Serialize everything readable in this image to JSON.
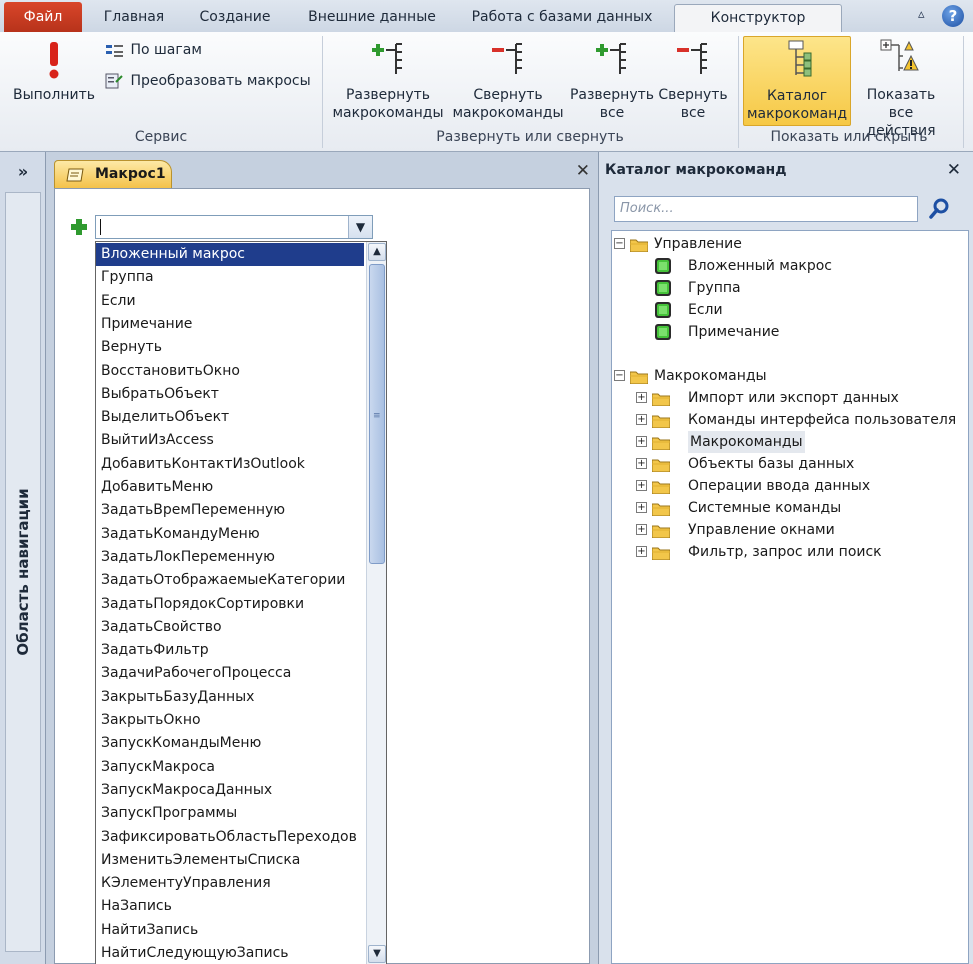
{
  "tabs": {
    "file": "Файл",
    "home": "Главная",
    "create": "Создание",
    "external": "Внешние данные",
    "database": "Работа с базами данных",
    "design": "Конструктор"
  },
  "ribbon": {
    "run": "Выполнить",
    "single_step": "По шагам",
    "convert_macros": "Преобразовать макросы",
    "group_tools": "Сервис",
    "expand_actions": [
      "Развернуть",
      "макрокоманды"
    ],
    "collapse_actions": [
      "Свернуть",
      "макрокоманды"
    ],
    "expand_all": [
      "Развернуть",
      "все"
    ],
    "collapse_all": [
      "Свернуть",
      "все"
    ],
    "group_expand": "Развернуть или свернуть",
    "action_catalog": [
      "Каталог",
      "макрокоманд"
    ],
    "show_all_actions": [
      "Показать",
      "все действия"
    ],
    "group_show": "Показать или скрыть"
  },
  "nav": {
    "toggle": "»",
    "label": "Область навигации"
  },
  "document": {
    "tab_title": "Макрос1",
    "close": "✕",
    "combo_value": "",
    "dropdown_items": [
      "Вложенный макрос",
      "Группа",
      "Если",
      "Примечание",
      "Вернуть",
      "ВосстановитьОкно",
      "ВыбратьОбъект",
      "ВыделитьОбъект",
      "ВыйтиИзAccess",
      "ДобавитьКонтактИзOutlook",
      "ДобавитьМеню",
      "ЗадатьВремПеременную",
      "ЗадатьКомандуМеню",
      "ЗадатьЛокПеременную",
      "ЗадатьОтображаемыеКатегории",
      "ЗадатьПорядокСортировки",
      "ЗадатьСвойство",
      "ЗадатьФильтр",
      "ЗадачиРабочегоПроцесса",
      "ЗакрытьБазуДанных",
      "ЗакрытьОкно",
      "ЗапускКомандыМеню",
      "ЗапускМакроса",
      "ЗапускМакросаДанных",
      "ЗапускПрограммы",
      "ЗафиксироватьОбластьПереходов",
      "ИзменитьЭлементыСписка",
      "КЭлементуУправления",
      "НаЗапись",
      "НайтиЗапись",
      "НайтиСледующуюЗапись"
    ],
    "selected_index": 0
  },
  "catalog": {
    "title": "Каталог макрокоманд",
    "close": "✕",
    "search_placeholder": "Поиск...",
    "tree": [
      {
        "label": "Управление",
        "level": 0,
        "kind": "folder",
        "expander": "−"
      },
      {
        "label": "Вложенный макрос",
        "level": 1,
        "kind": "macro"
      },
      {
        "label": "Группа",
        "level": 1,
        "kind": "macro"
      },
      {
        "label": "Если",
        "level": 1,
        "kind": "macro"
      },
      {
        "label": "Примечание",
        "level": 1,
        "kind": "macro"
      },
      {
        "label": "Макрокоманды",
        "level": 0,
        "kind": "folder",
        "expander": "−",
        "gap": true
      },
      {
        "label": "Импорт или экспорт данных",
        "level": 1,
        "kind": "folder",
        "expander": "+"
      },
      {
        "label": "Команды интерфейса пользователя",
        "level": 1,
        "kind": "folder",
        "expander": "+"
      },
      {
        "label": "Макрокоманды",
        "level": 1,
        "kind": "folder",
        "expander": "+",
        "highlight": true
      },
      {
        "label": "Объекты базы данных",
        "level": 1,
        "kind": "folder",
        "expander": "+"
      },
      {
        "label": "Операции ввода данных",
        "level": 1,
        "kind": "folder",
        "expander": "+"
      },
      {
        "label": "Системные команды",
        "level": 1,
        "kind": "folder",
        "expander": "+"
      },
      {
        "label": "Управление окнами",
        "level": 1,
        "kind": "folder",
        "expander": "+"
      },
      {
        "label": "Фильтр, запрос или поиск",
        "level": 1,
        "kind": "folder",
        "expander": "+"
      }
    ]
  },
  "colors": {
    "file_tab": "#c7371e",
    "selection": "#1f3d8c",
    "active_button": "#f6c845"
  }
}
